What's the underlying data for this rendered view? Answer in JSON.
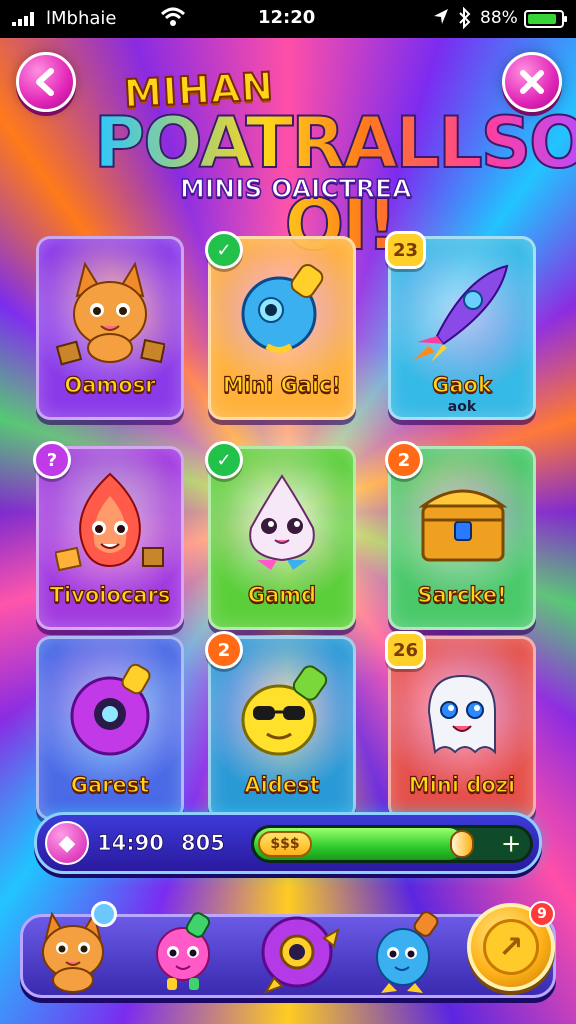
{
  "status_bar": {
    "carrier": "lMbhaie",
    "time": "12:20",
    "battery_pct": "88%"
  },
  "header": {
    "back_icon": "chevron-left-icon",
    "close_icon": "close-x-icon",
    "title_top": "MIHAN",
    "title_main": "POATRALLSO OI!",
    "title_sub": "MINIS OAICTREA"
  },
  "games": [
    {
      "label": "Oamosr",
      "sublabel": "",
      "badge": "",
      "badge_type": "",
      "color": "#8a3ae8",
      "icon": "fox-icon"
    },
    {
      "label": "Mini Gaic!",
      "sublabel": "",
      "badge": "✓",
      "badge_type": "check",
      "color": "#ffb13a",
      "icon": "blue-bulb-icon"
    },
    {
      "label": "Gaok",
      "sublabel": "aok",
      "badge": "23",
      "badge_type": "count",
      "color": "#35b9e6",
      "icon": "rocket-icon"
    },
    {
      "label": "Tivoiocars",
      "sublabel": "",
      "badge": "?",
      "badge_type": "purple",
      "color": "#a23ae0",
      "icon": "flame-creature-icon"
    },
    {
      "label": "Gamd",
      "sublabel": "",
      "badge": "✓",
      "badge_type": "check",
      "color": "#5bcf3a",
      "icon": "cute-ghost-icon"
    },
    {
      "label": "Sarcke!",
      "sublabel": "",
      "badge": "2",
      "badge_type": "num",
      "color": "#49c96a",
      "icon": "treasure-chest-icon"
    },
    {
      "label": "Garest",
      "sublabel": "",
      "badge": "",
      "badge_type": "",
      "color": "#4a6ae6",
      "icon": "purple-orb-icon"
    },
    {
      "label": "Aidest",
      "sublabel": "",
      "badge": "2",
      "badge_type": "num",
      "color": "#2a9ad6",
      "icon": "yellow-blob-icon"
    },
    {
      "label": "Mini dozi",
      "sublabel": "",
      "badge": "26",
      "badge_type": "count",
      "color": "#e6504a",
      "icon": "white-ghost-icon"
    }
  ],
  "progress": {
    "score_a": "14:90",
    "score_b": "805",
    "coin_label": "$$$",
    "fill_fraction": 0.76,
    "plus_label": "+"
  },
  "tray": {
    "items": [
      "fox-icon",
      "pink-creature-icon",
      "purple-orb-icon",
      "blue-bulb-icon"
    ],
    "coin_badge": "9"
  }
}
